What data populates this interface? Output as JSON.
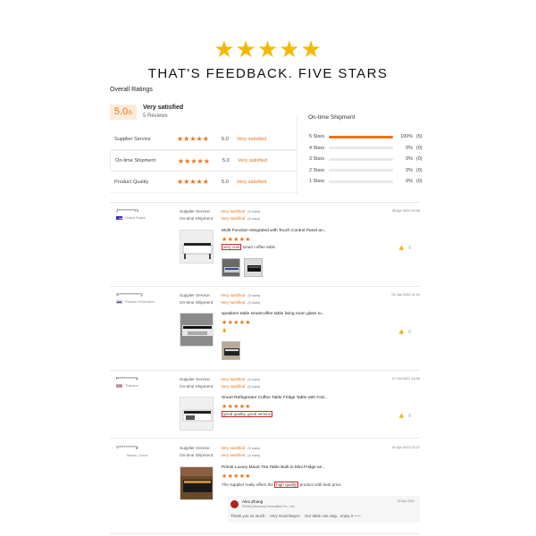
{
  "hero": {
    "stars": "★★★★★",
    "title": "THAT'S FEEDBACK. FIVE STARS"
  },
  "overall": {
    "label": "Overall Ratings",
    "score": "5.0",
    "score_suffix": "/5",
    "satisfaction": "Very satisfied",
    "reviews": "5 Reviews"
  },
  "ratings": [
    {
      "label": "Supplier Service",
      "stars": "★★★★★",
      "value": "5.0",
      "text": "Very satisfied"
    },
    {
      "label": "On-time Shipment",
      "stars": "★★★★★",
      "value": "5.0",
      "text": "Very satisfied"
    },
    {
      "label": "Product Quality",
      "stars": "★★★★★",
      "value": "5.0",
      "text": "Very satisfied"
    }
  ],
  "shipment": {
    "title": "On-time Shipment",
    "rows": [
      {
        "label": "5 Stars",
        "fraction": 1.0,
        "pct": "100%",
        "count": "(5)"
      },
      {
        "label": "4 Stars",
        "fraction": 0,
        "pct": "0%",
        "count": "(0)"
      },
      {
        "label": "3 Stars",
        "fraction": 0,
        "pct": "0%",
        "count": "(0)"
      },
      {
        "label": "2 Stars",
        "fraction": 0,
        "pct": "0%",
        "count": "(0)"
      },
      {
        "label": "1 Stars",
        "fraction": 0,
        "pct": "0%",
        "count": "(0)"
      }
    ]
  },
  "colors": {
    "accent": "#e8741a",
    "hero_star": "#f5b800",
    "highlight": "#d82020"
  },
  "review_labels": {
    "supplier": "Supplier Service:",
    "shipment": "On-time Shipment:",
    "value": "Very satisfied",
    "value_note": "(5 stars)"
  },
  "reviews": [
    {
      "user": "J**********m",
      "country": "United States",
      "date": "28 Apr 2022 00:38",
      "product": "Multi Function Integrated with Touch Control Panel an...",
      "stars": "★★★★★",
      "comment_highlight": "very cool",
      "comment_rest": " smart coffee table",
      "likes": "0"
    },
    {
      "user": "S*************y",
      "country": "Russian Federation",
      "date": "03 Jan 2022 01:34",
      "product": "speakers table smartcoffee table living room glass to...",
      "stars": "★★★★★",
      "comment_emoji": "👍",
      "likes": "0"
    },
    {
      "user": "P**********a",
      "country": "Thailand",
      "date": "17 Oct 2021 16:36",
      "product": "Smart Refrigerator Coffee Table Fridge Table with Frid...",
      "stars": "★★★★★",
      "comment_highlight": "good quality, good service",
      "likes": "0"
    },
    {
      "user": "V**********g",
      "country": "Taiwan, China",
      "date": "02 Apr 2021 02:27",
      "product": "Primst Luxury Music Tea Table Built in Mini Fridge an...",
      "stars": "★★★★★",
      "comment_before": "The supplier really offers the ",
      "comment_highlight": "high quality",
      "comment_after": " product with best price.",
      "likes": "0",
      "reply": {
        "name": "Alex Zhang",
        "company": "Primst (zhuzhou) Innovation Co., Ltd.",
        "date": "22 Apr 2021",
        "text": "Thank you so much： Very Good Buyer： Our table can sing、enjoy it ~~~"
      }
    }
  ]
}
